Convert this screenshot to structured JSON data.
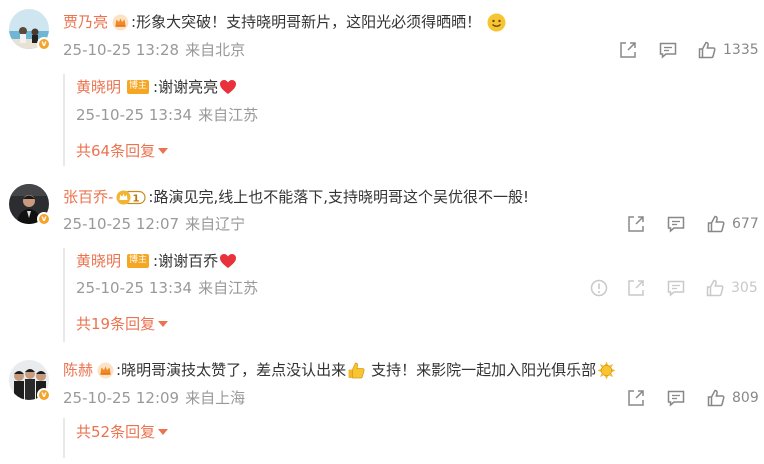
{
  "comments": [
    {
      "user": "贾乃亮",
      "text": ":形象大突破！支持晓明哥新片，这阳光必须得晒晒！",
      "time": "25-10-25 13:28",
      "location": "来自北京",
      "likes": "1335",
      "reply": {
        "user": "黄晓明",
        "badge": "博主",
        "text": ":谢谢亮亮",
        "time": "25-10-25 13:34",
        "location": "来自江苏"
      },
      "more_replies": "共64条回复"
    },
    {
      "user": "张百乔-",
      "level": "1",
      "text": ":路演见完,线上也不能落下,支持晓明哥这个吴优很不一般!",
      "time": "25-10-25 12:07",
      "location": "来自辽宁",
      "likes": "677",
      "reply": {
        "user": "黄晓明",
        "badge": "博主",
        "text": ":谢谢百乔",
        "time": "25-10-25 13:34",
        "location": "来自江苏",
        "likes": "305"
      },
      "more_replies": "共19条回复"
    },
    {
      "user": "陈赫",
      "text": ":晓明哥演技太赞了，差点没认出来",
      "text2": "支持！来影院一起加入阳光俱乐部",
      "time": "25-10-25 12:09",
      "location": "来自上海",
      "likes": "809",
      "more_replies": "共52条回复"
    }
  ],
  "colors": {
    "username": "#eb7350",
    "meta": "#999999",
    "badge": "#f5a623",
    "heart": "#e8313a"
  },
  "icons": [
    "crown-icon",
    "verified-icon",
    "share-icon",
    "comment-icon",
    "like-icon",
    "report-icon",
    "heart-icon",
    "smile-emoji",
    "thumbs-up-emoji",
    "sun-emoji",
    "level-badge"
  ]
}
